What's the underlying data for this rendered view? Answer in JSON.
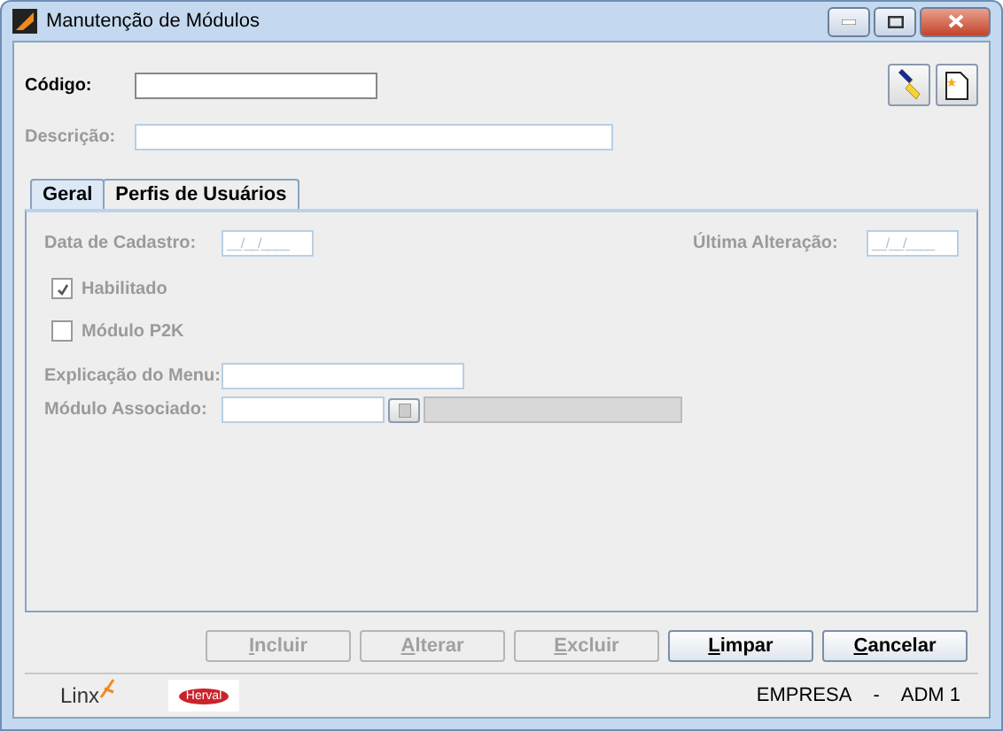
{
  "window": {
    "title": "Manutenção de Módulos"
  },
  "header": {
    "codigo": {
      "label": "Código:",
      "disabled": false
    },
    "descricao": {
      "label": "Descrição:",
      "disabled": true
    }
  },
  "tabs": [
    {
      "label": "Geral",
      "selected": true
    },
    {
      "label": "Perfis de Usuários",
      "selected": false
    }
  ],
  "form": {
    "data_cadastro": {
      "label": "Data de Cadastro:",
      "value": "__/__/____"
    },
    "ultima_alteracao": {
      "label": "Última Alteração:",
      "value": "__/__/____"
    },
    "checkboxes": [
      {
        "label": "Habilitado",
        "checked": true
      },
      {
        "label": "Módulo P2K",
        "checked": false
      }
    ],
    "explicacao": {
      "label": "Explicação do Menu:"
    },
    "modulo_associado": {
      "label": "Módulo Associado:"
    }
  },
  "buttons": [
    {
      "label": "Incluir",
      "disabled": true
    },
    {
      "label": "Alterar",
      "disabled": true
    },
    {
      "label": "Excluir",
      "disabled": true
    },
    {
      "label": "Limpar",
      "disabled": false
    },
    {
      "label": "Cancelar",
      "disabled": false
    }
  ],
  "status_bar": {
    "logos": [
      "Linx",
      "Herval"
    ],
    "empresa": "EMPRESA",
    "separator": "-",
    "user": "ADM 1"
  }
}
